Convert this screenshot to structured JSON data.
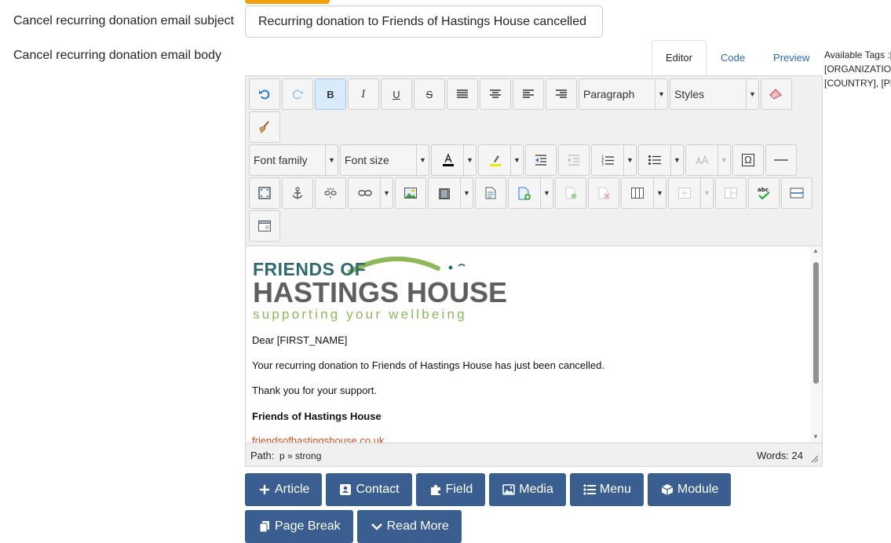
{
  "form": {
    "subject_label": "Cancel recurring donation email subject",
    "subject_value": "Recurring donation to Friends of Hastings House cancelled",
    "body_label": "Cancel recurring donation email body"
  },
  "tabs": [
    {
      "label": "Editor",
      "active": true
    },
    {
      "label": "Code",
      "active": false
    },
    {
      "label": "Preview",
      "active": false
    }
  ],
  "tags": {
    "line1": "Available Tags :[",
    "line2": "[ORGANIZATION",
    "line3": "[COUNTRY], [PH"
  },
  "toolbar": {
    "format_select": "Paragraph",
    "styles_select": "Styles",
    "font_family_select": "Font family",
    "font_size_select": "Font size",
    "bold_glyph": "B",
    "italic_glyph": "I",
    "underline_glyph": "U",
    "strike_glyph": "S",
    "special_char_glyph": "Ω",
    "spell_glyph": "abc"
  },
  "colors": {
    "accent": "#3a5e8f",
    "logo_teal": "#2f6b6e",
    "logo_grey": "#5f5f5f",
    "logo_green": "#8cb85a",
    "link": "#d04a1e"
  },
  "content": {
    "logo_line1": "FRIENDS OF",
    "logo_line2": "HASTINGS HOUSE",
    "logo_line3": "supporting your wellbeing",
    "greeting": "Dear [FIRST_NAME]",
    "para1": "Your recurring donation to Friends of Hastings House has just been cancelled.",
    "para2": "Thank you for your support.",
    "signature": "Friends of Hastings House",
    "link": "friendsofhastingshouse.co.uk"
  },
  "status": {
    "path_label": "Path:",
    "path_value": "p » strong",
    "words": "Words: 24"
  },
  "buttons": {
    "article": "Article",
    "contact": "Contact",
    "field": "Field",
    "media": "Media",
    "menu": "Menu",
    "module": "Module",
    "page_break": "Page Break",
    "read_more": "Read More"
  }
}
